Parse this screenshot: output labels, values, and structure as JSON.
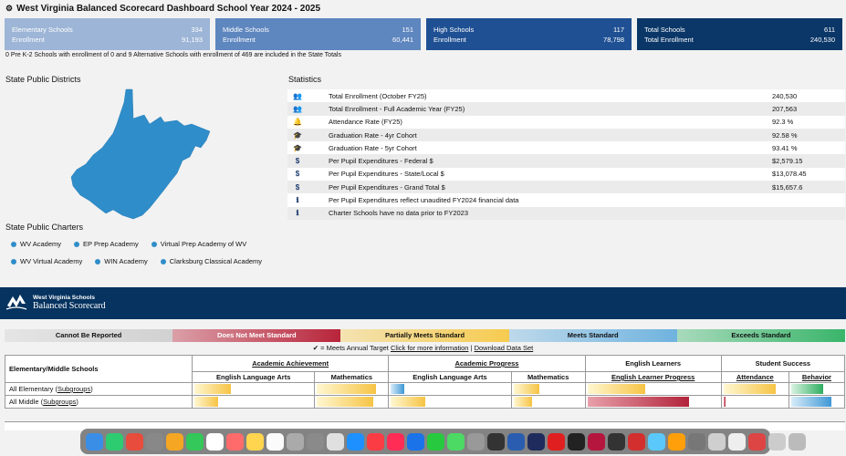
{
  "header": {
    "title": "West Virginia Balanced Scorecard Dashboard School Year 2024 - 2025",
    "icon": "dashboard-icon"
  },
  "cards": [
    {
      "label1": "Elementary Schools",
      "value1": "334",
      "label2": "Enrollment",
      "value2": "91,193",
      "color": "#9db5d6"
    },
    {
      "label1": "Middle Schools",
      "value1": "151",
      "label2": "Enrollment",
      "value2": "60,441",
      "color": "#5e86bf"
    },
    {
      "label1": "High Schools",
      "value1": "117",
      "label2": "Enrollment",
      "value2": "78,798",
      "color": "#1f5093"
    },
    {
      "label1": "Total Schools",
      "value1": "611",
      "label2": "Total Enrollment",
      "value2": "240,530",
      "color": "#0b3768"
    }
  ],
  "note": "0 Pre K-2 Schools with enrollment of 0 and 9 Alternative Schools with enrollment of 469 are included in the State Totals",
  "districts": {
    "title": "State Public Districts"
  },
  "charters": {
    "title": "State Public Charters",
    "rows": [
      [
        "WV Academy",
        "EP Prep Academy",
        "Virtual Prep Academy of WV"
      ],
      [
        "WV Virtual Academy",
        "WIN Academy",
        "Clarksburg Classical Academy"
      ]
    ]
  },
  "statistics": {
    "title": "Statistics",
    "items": [
      {
        "icon": "users-icon",
        "glyph": "👥",
        "label": "Total Enrollment (October FY25)",
        "value": "240,530"
      },
      {
        "icon": "users-icon",
        "glyph": "👥",
        "label": "Total Enrollment - Full Academic Year (FY25)",
        "value": "207,563"
      },
      {
        "icon": "bell-icon",
        "glyph": "🔔",
        "label": "Attendance Rate (FY25)",
        "value": "92.3 %"
      },
      {
        "icon": "graduation-cap-icon",
        "glyph": "🎓",
        "label": "Graduation Rate - 4yr Cohort",
        "value": "92.58 %"
      },
      {
        "icon": "graduation-cap-icon",
        "glyph": "🎓",
        "label": "Graduation Rate - 5yr Cohort",
        "value": "93.41 %"
      },
      {
        "icon": "dollar-icon",
        "glyph": "$",
        "label": "Per Pupil Expenditures - Federal $",
        "value": "$2,579.15"
      },
      {
        "icon": "dollar-icon",
        "glyph": "$",
        "label": "Per Pupil Expenditures - State/Local $",
        "value": "$13,078.45"
      },
      {
        "icon": "dollar-icon",
        "glyph": "$",
        "label": "Per Pupil Expenditures - Grand Total $",
        "value": "$15,657.6"
      },
      {
        "icon": "info-icon",
        "glyph": "ℹ",
        "label": "Per Pupil Expenditures reflect unaudited FY2024 financial data",
        "value": ""
      },
      {
        "icon": "info-icon",
        "glyph": "ℹ",
        "label": "Charter Schools have no data prior to FY2023",
        "value": ""
      }
    ]
  },
  "banner": {
    "line1": "West Virginia Schools",
    "line2": "Balanced Scorecard"
  },
  "legend": [
    {
      "label": "Cannot Be Reported",
      "bg": "#d1d1d1",
      "color": "#111"
    },
    {
      "label": "Does Not Meet Standard",
      "bg": "#b8243a",
      "color": "#fff"
    },
    {
      "label": "Partially Meets Standard",
      "bg": "#f6cb4f",
      "color": "#111"
    },
    {
      "label": "Meets Standard",
      "bg": "#6fb3df",
      "color": "#111"
    },
    {
      "label": "Exceeds Standard",
      "bg": "#39b56a",
      "color": "#111"
    }
  ],
  "keyline": {
    "text": "= Meets Annual Target",
    "link1": "Click for more information",
    "sep": "|",
    "link2": "Download Data Set"
  },
  "table": {
    "first_header": "Elementary/Middle Schools",
    "groups": [
      "Academic Achievement",
      "Academic Progress",
      "English Learners",
      "Student Success"
    ],
    "subheaders": [
      "English Language Arts",
      "Mathematics",
      "English Language Arts",
      "Mathematics",
      "English Learner Progress",
      "Attendance",
      "Behavior"
    ],
    "rows": [
      {
        "label": "All Elementary",
        "link": "Subgroups",
        "bars": [
          {
            "fill": 0.31,
            "level": "partial"
          },
          {
            "fill": 0.85,
            "level": "partial"
          },
          {
            "fill": 0.11,
            "level": "meets"
          },
          {
            "fill": 0.37,
            "level": "partial"
          },
          {
            "fill": 0.44,
            "level": "partial"
          },
          {
            "fill": 0.83,
            "level": "partial"
          },
          {
            "fill": 0.62,
            "level": "exceeds"
          }
        ]
      },
      {
        "label": "All Middle",
        "link": "Subgroups",
        "bars": [
          {
            "fill": 0.2,
            "level": "partial"
          },
          {
            "fill": 0.81,
            "level": "partial"
          },
          {
            "fill": 0.29,
            "level": "partial"
          },
          {
            "fill": 0.27,
            "level": "partial"
          },
          {
            "fill": 0.77,
            "level": "notmeet"
          },
          {
            "fill": 0.03,
            "level": "notmeet"
          },
          {
            "fill": 0.78,
            "level": "meets"
          }
        ]
      }
    ]
  }
}
